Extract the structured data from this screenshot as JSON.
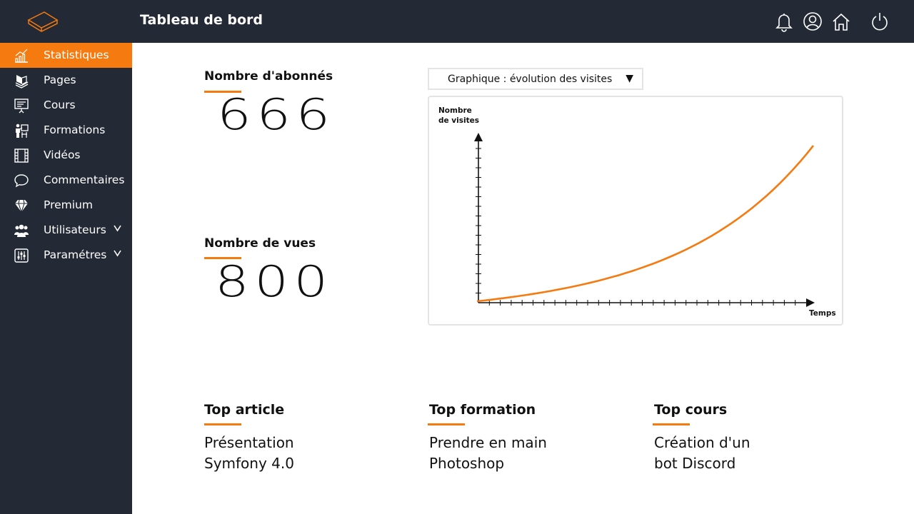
{
  "header": {
    "title": "Tableau de bord",
    "icons": [
      "bell-icon",
      "user-icon",
      "home-icon",
      "power-icon"
    ]
  },
  "sidebar": {
    "items": [
      {
        "label": "Statistiques",
        "icon": "chart-icon",
        "active": true
      },
      {
        "label": "Pages",
        "icon": "pages-icon"
      },
      {
        "label": "Cours",
        "icon": "presentation-icon"
      },
      {
        "label": "Formations",
        "icon": "training-icon"
      },
      {
        "label": "Vidéos",
        "icon": "film-icon"
      },
      {
        "label": "Commentaires",
        "icon": "comment-icon"
      },
      {
        "label": "Premium",
        "icon": "diamond-icon"
      },
      {
        "label": "Utilisateurs",
        "icon": "users-icon",
        "expandable": true
      },
      {
        "label": "Paramétres",
        "icon": "sliders-icon",
        "expandable": true
      }
    ]
  },
  "stats": {
    "subscribers_label": "Nombre d'abonnés",
    "subscribers_value": "666",
    "views_label": "Nombre de vues",
    "views_value": "800"
  },
  "chart": {
    "select_value": "Graphique : évolution des visites"
  },
  "chart_data": {
    "type": "line",
    "ylabel_line1": "Nombre",
    "ylabel_line2": "de visites",
    "xlabel": "Temps",
    "grid": false,
    "ticks_x": 0,
    "series": [
      {
        "color": "#f57a10",
        "shape": "exponential",
        "x": [
          0,
          0.25,
          0.5,
          0.75,
          1.0
        ],
        "y": [
          0,
          0.12,
          0.3,
          0.55,
          1.0
        ]
      }
    ]
  },
  "top": {
    "article": {
      "title": "Top article",
      "line1": "Présentation",
      "line2": "Symfony 4.0"
    },
    "formation": {
      "title": "Top formation",
      "line1": "Prendre en main",
      "line2": "Photoshop"
    },
    "cours": {
      "title": "Top cours",
      "line1": "Création d'un",
      "line2": "bot Discord"
    }
  },
  "colors": {
    "accent": "#f57a10",
    "sidebar": "#232a36"
  }
}
